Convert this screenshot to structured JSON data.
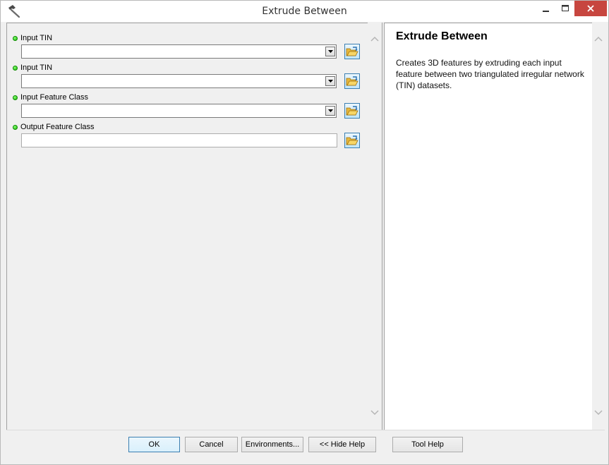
{
  "window": {
    "title": "Extrude Between",
    "icon": "hammer-icon"
  },
  "parameters": [
    {
      "label": "Input TIN",
      "type": "combo",
      "value": "",
      "required": true
    },
    {
      "label": "Input TIN",
      "type": "combo",
      "value": "",
      "required": true
    },
    {
      "label": "Input Feature Class",
      "type": "combo",
      "value": "",
      "required": true
    },
    {
      "label": "Output Feature Class",
      "type": "text",
      "value": "",
      "required": true
    }
  ],
  "help": {
    "title": "Extrude Between",
    "description": "Creates 3D features by extruding each input feature between two triangulated irregular network (TIN) datasets."
  },
  "buttons": {
    "ok": "OK",
    "cancel": "Cancel",
    "environments": "Environments...",
    "hide_help": "<< Hide Help",
    "tool_help": "Tool Help"
  },
  "colors": {
    "required_dot": "#16b400",
    "close_button": "#c7463f"
  }
}
